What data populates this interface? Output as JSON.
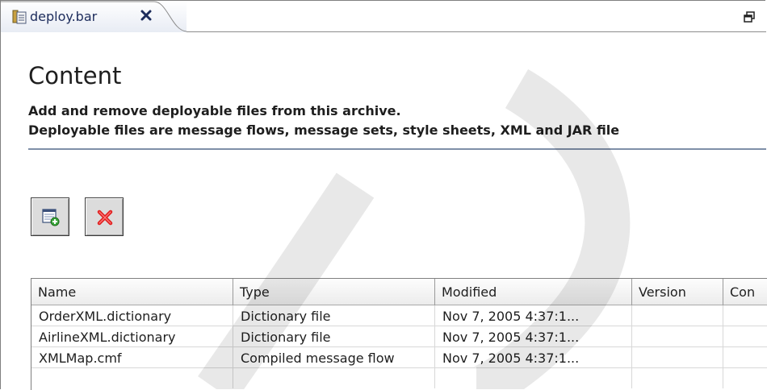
{
  "tab": {
    "title": "deploy.bar",
    "icon": "archive-file-icon",
    "close_icon": "close-icon",
    "restore_icon": "restore-view-icon"
  },
  "content": {
    "heading": "Content",
    "description_line1": "Add and remove deployable files from this archive.",
    "description_line2": "Deployable files are message flows, message sets, style sheets, XML and JAR file"
  },
  "toolbar": {
    "add_icon": "add-file-icon",
    "remove_icon": "remove-icon"
  },
  "table": {
    "columns": [
      "Name",
      "Type",
      "Modified",
      "Version",
      "Con"
    ],
    "rows": [
      [
        "OrderXML.dictionary",
        "Dictionary file",
        "Nov 7, 2005  4:37:1...",
        "",
        ""
      ],
      [
        "AirlineXML.dictionary",
        "Dictionary file",
        "Nov 7, 2005  4:37:1...",
        "",
        ""
      ],
      [
        "XMLMap.cmf",
        "Compiled message flow",
        "Nov 7, 2005  4:37:1...",
        "",
        ""
      ]
    ]
  },
  "colors": {
    "accent": "#1d2c5c",
    "separator": "#7f8fa8",
    "remove_red": "#e02020"
  }
}
